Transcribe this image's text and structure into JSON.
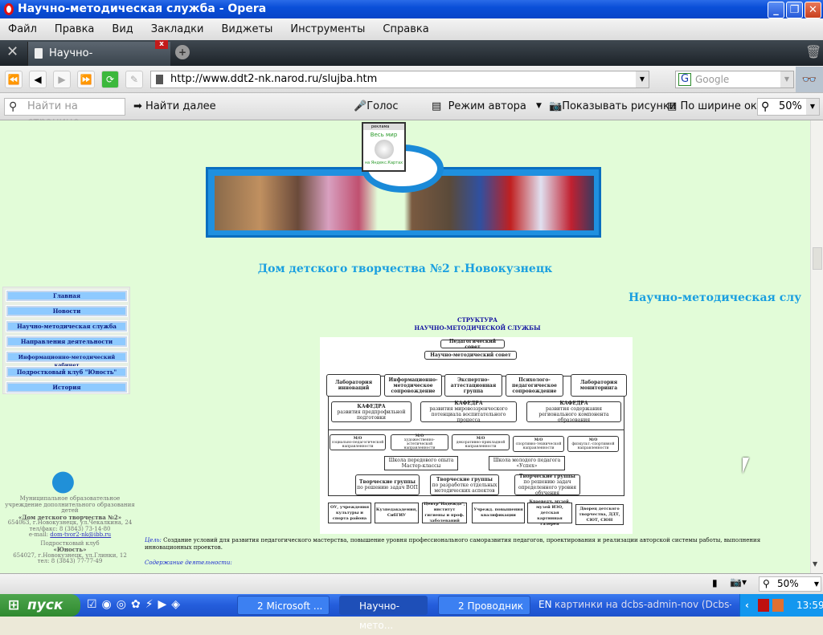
{
  "window": {
    "title": "Научно-методическая служба - Opera",
    "min": "_",
    "max": "❐",
    "close": "✕"
  },
  "menu": [
    "Файл",
    "Правка",
    "Вид",
    "Закладки",
    "Виджеты",
    "Инструменты",
    "Справка"
  ],
  "tab": {
    "label": "Научно-методическая ...",
    "close": "x"
  },
  "address": {
    "url": "http://www.ddt2-nk.narod.ru/slujba.htm",
    "search_placeholder": "Google"
  },
  "findbar": {
    "find_placeholder": "Найти на странице",
    "find_next": "Найти далее",
    "voice": "Голос",
    "author_mode": "Режим автора",
    "show_images": "Показывать рисунки",
    "fit_width": "По ширине окна",
    "zoom": "50%"
  },
  "page": {
    "widget": {
      "title": "реклама",
      "text": "Весь мир",
      "link": "на Яндекс.Картах"
    },
    "site_title": "Дом детского творчества №2 г.Новокузнецк",
    "section_title": "Научно-методическая слу",
    "nav": [
      "Главная",
      "Новости",
      "Научно-методическая служба",
      "Направления деятельности",
      "Информационно-методический кабинет",
      "Подростковый клуб \"Юность\"",
      "История"
    ],
    "structure_title": [
      "СТРУКТУРА",
      "НАУЧНО-МЕТОДИЧЕСКОЙ СЛУЖБЫ"
    ],
    "diagram": {
      "top": [
        "Педагогический совет",
        "Научно-методический совет"
      ],
      "level1": [
        "Лаборатория инноваций",
        "Информационно-методическое сопровождение",
        "Экспертно-аттестационная группа",
        "Психолого-педагогическое сопровождение",
        "Лаборатория мониторинга"
      ],
      "kafedra": [
        [
          "КАФЕДРА",
          "развития предпрофильной подготовки"
        ],
        [
          "КАФЕДРА",
          "развития мировоззренческого потенциала воспитательного процесса"
        ],
        [
          "КАФЕДРА",
          "развития содержания регионального компонента образования"
        ]
      ],
      "mo": [
        [
          "М/О",
          "социально-педагогической направленности"
        ],
        [
          "М/О",
          "художественно-эстетической направленности"
        ],
        [
          "М/О",
          "декоративно-прикладной направленности"
        ],
        [
          "М/О",
          "спортивно-технической направленности"
        ],
        [
          "М/О",
          "физкульт.-спортивной направленности"
        ]
      ],
      "schools": [
        "Школа передового опыта Мастер-классы",
        "Школа молодого педагога «Успех»"
      ],
      "groups": [
        [
          "Творческие группы",
          "по решению задач ВОП"
        ],
        [
          "Творческие группы",
          "по разработке отдельных методических аспектов"
        ],
        [
          "Творческие группы",
          "по решению задач определенного уровня обучения"
        ]
      ],
      "partners": [
        "ОУ, учреждения культуры и спорта района",
        "Кузпедакадемия, СибГИУ",
        "Центр\"Надежда\", институт гигиены и проф. заболеваний",
        "Учрежд. повышения квалификации",
        "Краеведч. музей, музей ИЗО, детская картинная галерея",
        "Дворец детского творчества, ДДТ, СЮТ, СЮН"
      ]
    },
    "footer": {
      "org1": "Муниципальное образовательное учреждение дополнительного образования детей",
      "name1": "«Дом детского творчества №2»",
      "addr1": "654063, г.Новокузнецк, ул.Чекалкина, 24",
      "phone1": "тел/факс: 8 (3843) 73-14-80",
      "email_label": "e-mail:",
      "email": "dom-tvor2-nk@ibb.ru",
      "club": "Подростковый клуб",
      "name2": "«Юность»",
      "addr2": "654027, г.Новокузнецк, ул.Глинки, 12",
      "phone2": "тел: 8 (3843) 77-77-49"
    },
    "goal_label": "Цель:",
    "goal_text": "Создание условий для развития педагогического мастерства, повышение уровня профессионального саморазвития педагогов, проектирования и реализации авторской системы работы, выполнения инновационных проектов.",
    "content_label": "Содержание деятельности:"
  },
  "status": {
    "zoom": "50%"
  },
  "taskbar": {
    "start": "пуск",
    "tasks": [
      "2 Microsoft ...",
      "Научно-мето...",
      "2 Проводник"
    ],
    "lang": "EN",
    "ticker": "картинки на dcbs-admin-nov (Dcbs-admin-",
    "clock": "13:59"
  }
}
